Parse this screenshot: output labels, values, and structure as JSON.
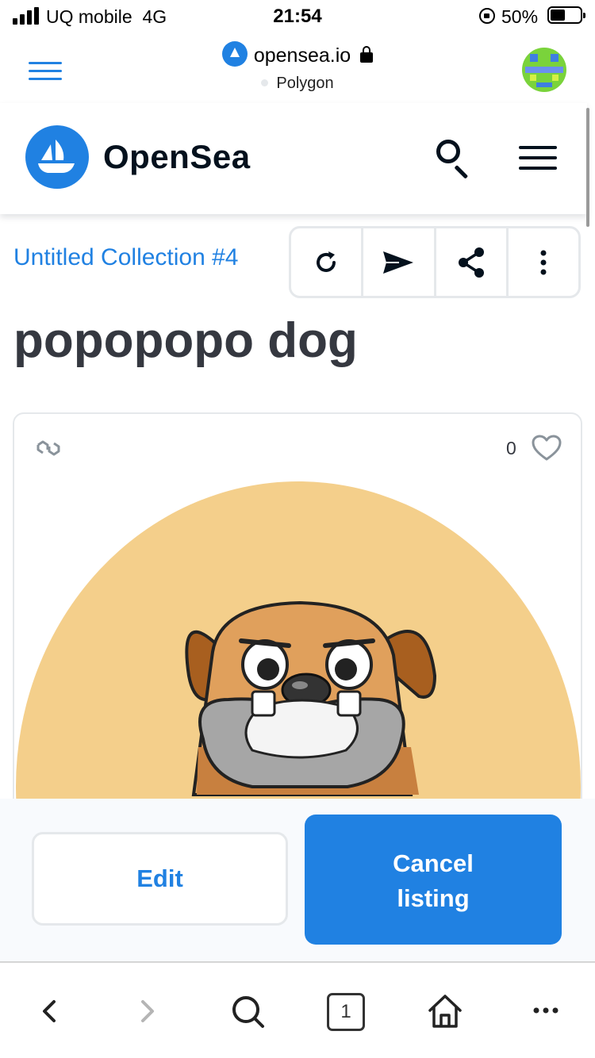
{
  "status_bar": {
    "carrier": "UQ mobile",
    "network": "4G",
    "time": "21:54",
    "battery": "50%"
  },
  "browser": {
    "domain": "opensea.io",
    "network_label": "Polygon"
  },
  "header": {
    "brand": "OpenSea"
  },
  "item": {
    "collection": "Untitled Collection #4",
    "title": "popopopo dog",
    "favorites_count": "0"
  },
  "actions": {
    "edit_label": "Edit",
    "cancel_label_line1": "Cancel",
    "cancel_label_line2": "listing"
  },
  "toolbar": {
    "tab_count": "1"
  },
  "colors": {
    "accent": "#2081e2",
    "title_text": "#353840",
    "artwork_bg": "#f4cf8b"
  },
  "icons": [
    "signal-icon",
    "rotation-lock-icon",
    "battery-icon",
    "opensea-favicon-icon",
    "lock-icon",
    "browser-menu-icon",
    "opensea-logo-icon",
    "search-icon",
    "menu-icon",
    "refresh-icon",
    "send-icon",
    "share-icon",
    "more-vertical-icon",
    "polygon-chain-icon",
    "heart-icon",
    "back-icon",
    "forward-icon",
    "browser-search-icon",
    "home-icon",
    "more-horizontal-icon"
  ]
}
